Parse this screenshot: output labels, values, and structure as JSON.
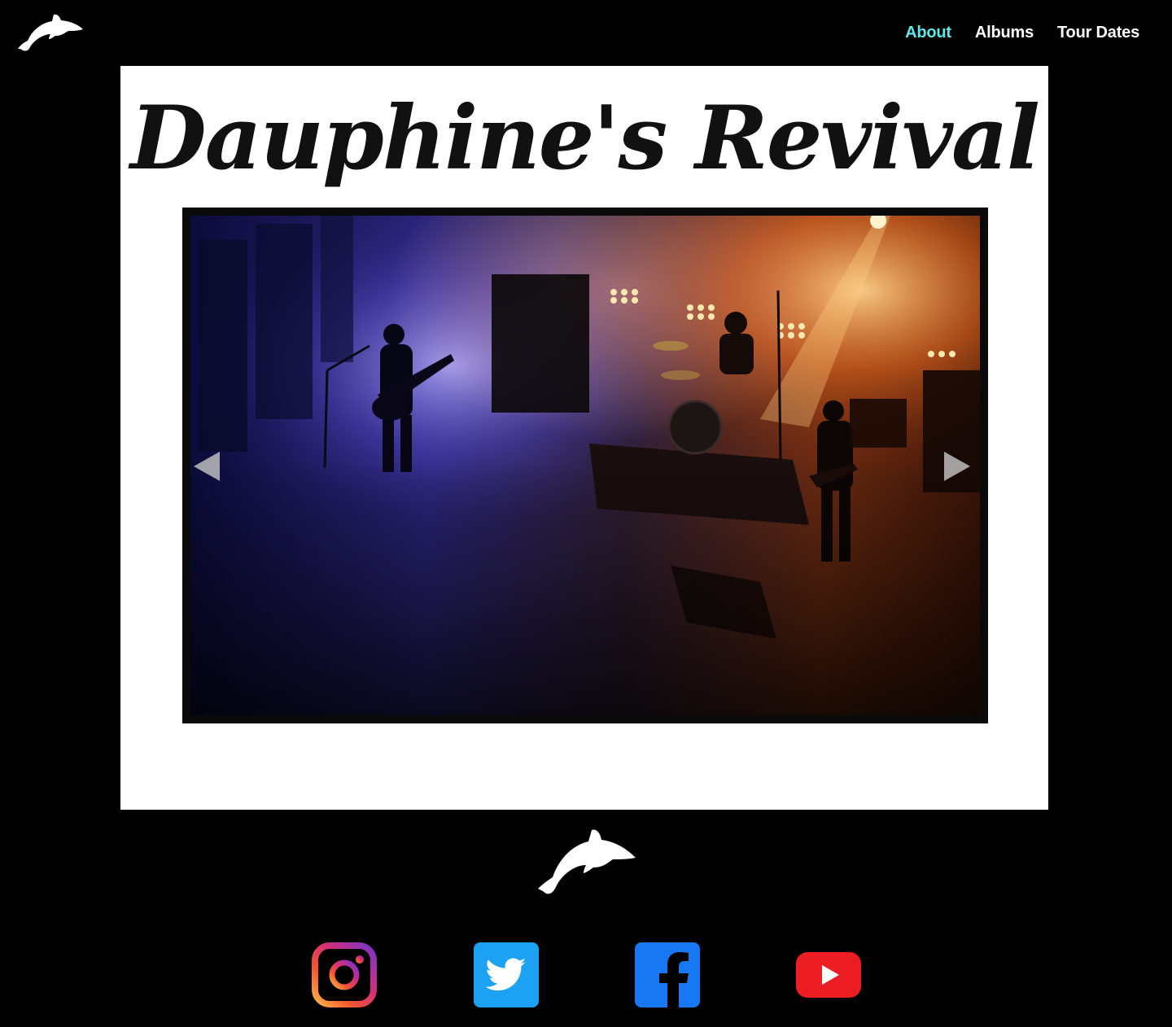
{
  "nav": {
    "items": [
      {
        "label": "About",
        "active": true
      },
      {
        "label": "Albums",
        "active": false
      },
      {
        "label": "Tour Dates",
        "active": false
      }
    ]
  },
  "hero": {
    "title": "Dauphine's Revival"
  },
  "slider": {
    "prev_icon": "triangle-left-icon",
    "next_icon": "triangle-right-icon"
  },
  "social": [
    {
      "name": "instagram-icon"
    },
    {
      "name": "twitter-icon"
    },
    {
      "name": "facebook-icon"
    },
    {
      "name": "youtube-icon"
    }
  ],
  "colors": {
    "background": "#000000",
    "card": "#ffffff",
    "nav_active": "#5fe8e8",
    "nav_text": "#ffffff",
    "twitter": "#1da1f2",
    "facebook": "#1877f2",
    "youtube": "#ff0000"
  }
}
